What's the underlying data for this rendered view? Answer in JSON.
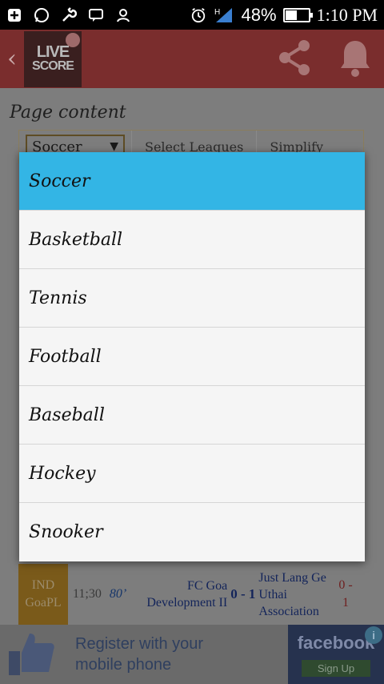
{
  "status_bar": {
    "battery_percent": "48%",
    "battery_level": 0.48,
    "time": "1:10 PM",
    "signal_label": "H",
    "icons": [
      "plus-icon",
      "whatsapp-icon",
      "wrench-icon",
      "chat-icon",
      "contacts-icon",
      "alarm-icon",
      "signal-icon",
      "battery-icon"
    ]
  },
  "app_bar": {
    "logo_line1": "LIVE",
    "logo_line2": "SCORE",
    "icons": [
      "back-icon",
      "share-icon",
      "bell-icon"
    ]
  },
  "page": {
    "title": "Page content",
    "filter": {
      "selected_sport": "Soccer",
      "tabs": [
        "Select Leagues",
        "Simplify"
      ]
    },
    "visible_match": {
      "league_code": "IND",
      "league_name": "GoaPL",
      "time": "11;30",
      "minute": "80’",
      "home_team_line1": "FC Goa",
      "home_team_line2": "Development II",
      "score": "0 - 1",
      "away_team_line1": "Just Lang Ge",
      "away_team_line2": "Uthai",
      "away_team_line3": "Association",
      "side_score_line1": "0 -",
      "side_score_line2": "1"
    }
  },
  "dropdown": {
    "options": [
      {
        "label": "Soccer",
        "selected": true
      },
      {
        "label": "Basketball",
        "selected": false
      },
      {
        "label": "Tennis",
        "selected": false
      },
      {
        "label": "Football",
        "selected": false
      },
      {
        "label": "Baseball",
        "selected": false
      },
      {
        "label": "Hockey",
        "selected": false
      },
      {
        "label": "Snooker",
        "selected": false
      }
    ]
  },
  "ad_banner": {
    "text_line1": "Register with your",
    "text_line2": "mobile phone",
    "brand": "facebook",
    "button_label": "Sign Up",
    "info_glyph": "i"
  },
  "colors": {
    "dropdown_selected": "#33b5e5",
    "app_bar": "#c0392b",
    "status_bar": "#000000"
  }
}
